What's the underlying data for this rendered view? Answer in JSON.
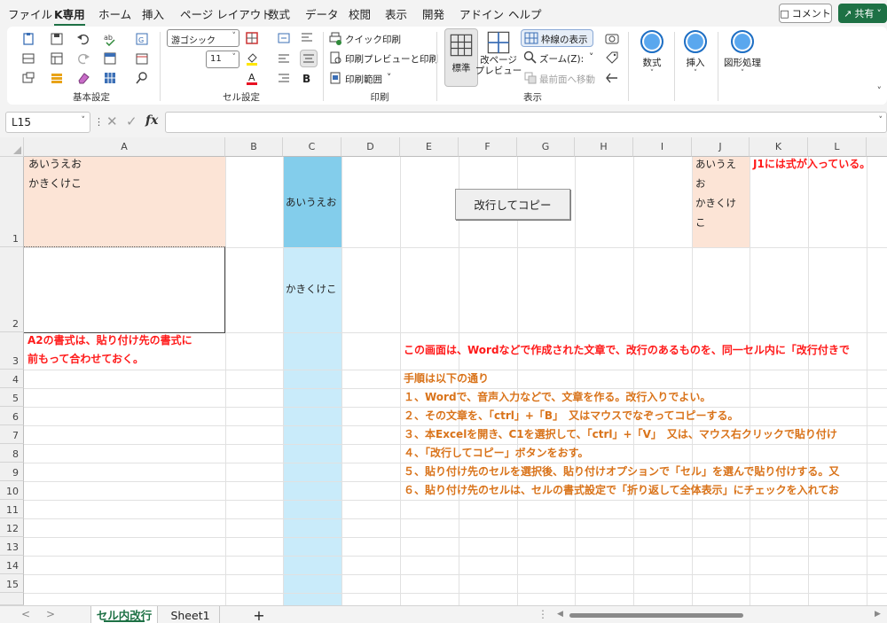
{
  "menu": {
    "items": [
      "ファイル",
      "K専用",
      "ホーム",
      "挿入",
      "ページ レイアウト",
      "数式",
      "データ",
      "校閲",
      "表示",
      "開発",
      "アドイン",
      "ヘルプ"
    ],
    "active": "K専用",
    "comment_label": "コメント",
    "share_label": "共有"
  },
  "ribbon": {
    "groups": {
      "basic": "基本設定",
      "cell": "セル設定",
      "print": "印刷",
      "view": "表示"
    },
    "font_name": "游ゴシック",
    "font_size": "11",
    "quick_print": "クイック印刷",
    "print_preview": "印刷プレビューと印刷",
    "print_area": "印刷範囲",
    "standard": "標準",
    "page_break_preview": "改ページ\nプレビュー",
    "show_gridlines": "枠線の表示",
    "zoom": "ズーム(Z):",
    "to_front": "最前面へ移動",
    "formula": "数式",
    "insert": "挿入",
    "shape": "図形処理"
  },
  "formula_bar": {
    "name_box": "L15",
    "fx": "fx",
    "value": ""
  },
  "columns": [
    "A",
    "B",
    "C",
    "D",
    "E",
    "F",
    "G",
    "H",
    "I",
    "J",
    "K",
    "L"
  ],
  "rows": [
    "1",
    "2",
    "3",
    "4",
    "5",
    "6",
    "7",
    "8",
    "9",
    "10",
    "11",
    "12",
    "13",
    "14",
    "15"
  ],
  "cells": {
    "a1_line1": "あいうえお",
    "a1_line2": "かきくけこ",
    "c1": "あいうえお",
    "c2": "かきくけこ",
    "j1_line1": "あいうえ",
    "j1_line2": "お",
    "j1_line3": "かきくけ",
    "j1_line4": "こ",
    "k1_note": "J1には式が入っている。",
    "a3_line1": "A2の書式は、貼り付け先の書式に",
    "a3_line2": "前もって合わせておく。",
    "e3": "この画面は、Wordなどで作成された文章で、改行のあるものを、同一セル内に「改行付きで",
    "e4": "手順は以下の通り",
    "e5": "１、Wordで、音声入力などで、文章を作る。改行入りでよい。",
    "e6": "２、その文章を、「ctrl」+「B」　又はマウスでなぞってコピーする。",
    "e7": "３、本Excelを開き、C1を選択して、「ctrl」+「V」　又は、マウス右クリックで貼り付け",
    "e8": "４、「改行してコピー」ボタンをおす。",
    "e9": "５、貼り付け先のセルを選択後、貼り付けオプションで「セル」を選んで貼り付けする。又",
    "e10": "６、貼り付け先のセルは、セルの書式設定で「折り返して全体表示」にチェックを入れてお"
  },
  "button": {
    "copy_with_newline": "改行してコピー"
  },
  "sheets": {
    "tabs": [
      "セル内改行",
      "Sheet1"
    ],
    "active": "セル内改行",
    "add": "+"
  },
  "colors": {
    "accent_green": "#1e7145",
    "salmon_fill": "#fce4d6",
    "blue_fill": "#83cdeb",
    "light_blue_fill": "#c9ebfa",
    "red_text": "#ff1a1a",
    "orange_text": "#d9731a"
  }
}
